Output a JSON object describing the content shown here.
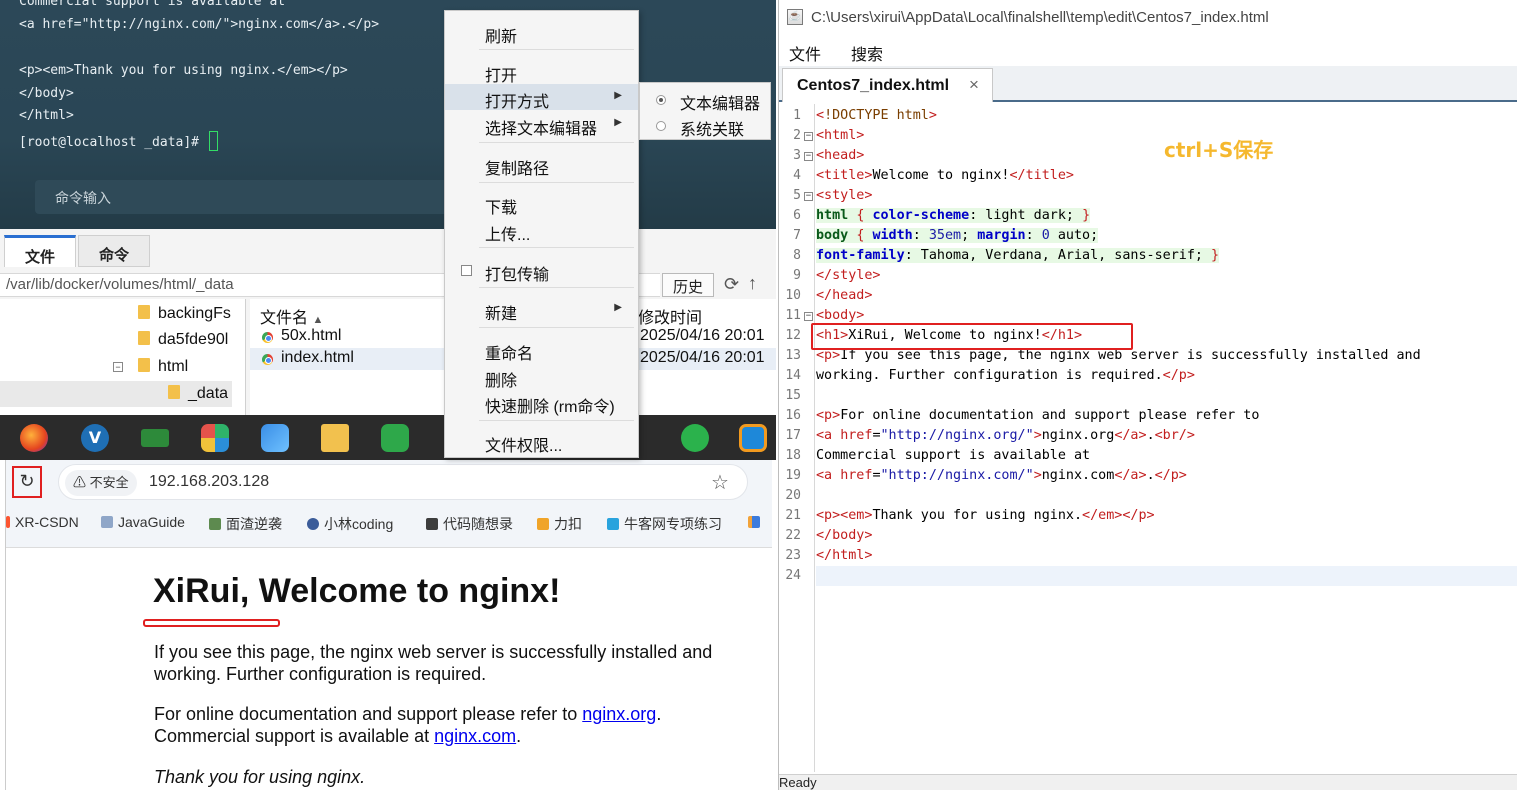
{
  "terminal": {
    "lines": [
      "Commercial support is available at",
      "<a href=\"http://nginx.com/\">nginx.com</a>.</p>",
      "",
      "<p><em>Thank you for using nginx.</em></p>",
      "</body>",
      "</html>",
      "[root@localhost _data]# "
    ],
    "command_input_label": "命令输入"
  },
  "file_manager": {
    "tabs": [
      "文件",
      "命令"
    ],
    "path": "/var/lib/docker/volumes/html/_data",
    "history_label": "历史",
    "tree": [
      "backingFs",
      "da5fde90l",
      "html",
      "_data"
    ],
    "columns": {
      "name": "文件名",
      "mtime": "修改时间"
    },
    "files": [
      {
        "name": "50x.html",
        "mtime": "2025/04/16 20:01"
      },
      {
        "name": "index.html",
        "mtime": "2025/04/16 20:01"
      }
    ]
  },
  "context_menu": {
    "items": [
      "刷新",
      "打开",
      "打开方式",
      "选择文本编辑器",
      "复制路径",
      "下载",
      "上传...",
      "打包传输",
      "新建",
      "重命名",
      "删除",
      "快速删除 (rm命令)",
      "文件权限..."
    ],
    "submenu": [
      "文本编辑器",
      "系统关联"
    ]
  },
  "browser": {
    "security_label": "不安全",
    "url": "192.168.203.128",
    "bookmarks": [
      "XR-CSDN",
      "JavaGuide",
      "面渣逆袭",
      "小林coding",
      "代码随想录",
      "力扣",
      "牛客网专项练习"
    ],
    "page": {
      "h1": "XiRui, Welcome to nginx!",
      "p1_line1": "If you see this page, the nginx web server is successfully installed and",
      "p1_line2": "working. Further configuration is required.",
      "p2_prefix": "For online documentation and support please refer to ",
      "p2_link": "nginx.org",
      "p2_suffix": ".",
      "p3_prefix": "Commercial support is available at ",
      "p3_link": "nginx.com",
      "p3_suffix": ".",
      "thanks": "Thank you for using nginx."
    }
  },
  "editor": {
    "title": "C:\\Users\\xirui\\AppData\\Local\\finalshell\\temp\\edit\\Centos7_index.html",
    "menus": [
      "文件",
      "搜索"
    ],
    "tab_label": "Centos7_index.html",
    "line_numbers": [
      "1",
      "2",
      "3",
      "4",
      "5",
      "6",
      "7",
      "8",
      "9",
      "10",
      "11",
      "12",
      "13",
      "14",
      "15",
      "16",
      "17",
      "18",
      "19",
      "20",
      "21",
      "22",
      "23",
      "24"
    ],
    "save_hint": "ctrl+S保存",
    "status": "Ready"
  },
  "colors": {
    "accent_red": "#e02020",
    "hint_yellow": "#f5b82e",
    "terminal_bg": "#2c4858",
    "tab_accent": "#2a6fd1"
  }
}
